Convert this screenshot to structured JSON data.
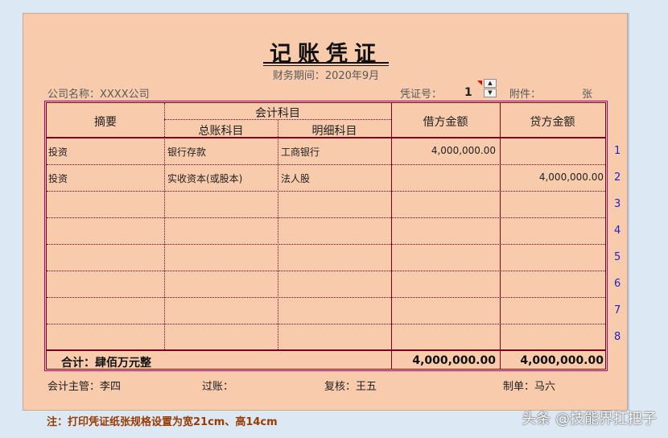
{
  "title": "记账凭证",
  "period": "财务期间：2020年9月",
  "company": "公司名称：XXXX公司",
  "voucher_label": "凭证号：",
  "voucher_no": "1",
  "attach_label": "附件：",
  "attach_unit": "张",
  "headers": {
    "summary": "摘要",
    "subject": "会计科目",
    "general": "总账科目",
    "detail": "明细科目",
    "debit": "借方金额",
    "credit": "贷方金额"
  },
  "rows": [
    {
      "summary": "投资",
      "general": "银行存款",
      "detail": "工商银行",
      "debit": "4,000,000.00",
      "credit": ""
    },
    {
      "summary": "投资",
      "general": "实收资本(或股本)",
      "detail": "法人股",
      "debit": "",
      "credit": "4,000,000.00"
    },
    {
      "summary": "",
      "general": "",
      "detail": "",
      "debit": "",
      "credit": ""
    },
    {
      "summary": "",
      "general": "",
      "detail": "",
      "debit": "",
      "credit": ""
    },
    {
      "summary": "",
      "general": "",
      "detail": "",
      "debit": "",
      "credit": ""
    },
    {
      "summary": "",
      "general": "",
      "detail": "",
      "debit": "",
      "credit": ""
    },
    {
      "summary": "",
      "general": "",
      "detail": "",
      "debit": "",
      "credit": ""
    },
    {
      "summary": "",
      "general": "",
      "detail": "",
      "debit": "",
      "credit": ""
    }
  ],
  "row_numbers": [
    "1",
    "2",
    "3",
    "4",
    "5",
    "6",
    "7",
    "8"
  ],
  "total": {
    "label": "合计：肆佰万元整",
    "debit": "4,000,000.00",
    "credit": "4,000,000.00"
  },
  "signatures": {
    "supervisor": "会计主管：李四",
    "posting": "过账：",
    "review": "复核：王五",
    "preparer": "制单：马六"
  },
  "note": "注：打印凭证纸张规格设置为宽21cm、高14cm",
  "watermark": "头条 @技能界扛把子",
  "colors": {
    "sheet": "#f8cbad",
    "grid": "#7a0020",
    "row_number": "#1f1fcc",
    "note": "#9c3a00"
  }
}
